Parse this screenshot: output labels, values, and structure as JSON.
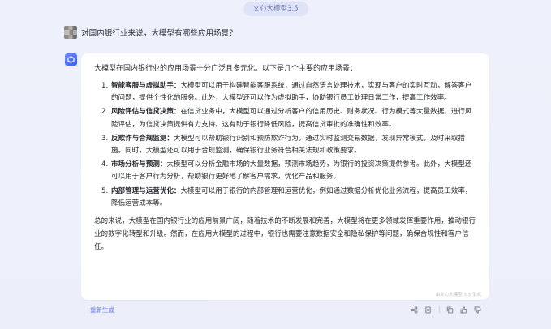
{
  "header": {
    "model_label": "文心大模型3.5"
  },
  "user": {
    "question": "对国内银行业来说，大模型有哪些应用场景？"
  },
  "answer": {
    "intro": "大模型在国内银行业的应用场景十分广泛且多元化。以下是几个主要的应用场景：",
    "points": [
      {
        "num": "1.",
        "title": "智能客服与虚拟助手：",
        "text": "大模型可以用于构建智能客服系统，通过自然语言处理技术，实现与客户的实时互动，解答客户的问题，提供个性化的服务。此外，大模型还可以作为虚拟助手，协助银行员工处理日常工作，提高工作效率。"
      },
      {
        "num": "2.",
        "title": "风险评估与信贷决策：",
        "text": "在信贷业务中，大模型可以通过分析客户的信用历史、财务状况、行为模式等大量数据，进行风险评估，为信贷决策提供有力支持。这有助于银行降低风险，提高信贷审批的准确性和效率。"
      },
      {
        "num": "3.",
        "title": "反欺诈与合规监测：",
        "text": "大模型可以帮助银行识别和预防欺诈行为，通过实时监测交易数据，发现异常模式，及时采取措施。同时，大模型还可以用于合规监测，确保银行业务符合相关法规和政策要求。"
      },
      {
        "num": "4.",
        "title": "市场分析与预测：",
        "text": "大模型可以分析金融市场的大量数据，预测市场趋势，为银行的投资决策提供参考。此外，大模型还可以用于客户行为分析，帮助银行更好地了解客户需求，优化产品和服务。"
      },
      {
        "num": "5.",
        "title": "内部管理与运营优化：",
        "text": "大模型可以用于银行的内部管理和运营优化，例如通过数据分析优化业务流程，提高员工效率，降低运营成本等。"
      }
    ],
    "summary": "总的来说，大模型在国内银行业的应用前景广阔，随着技术的不断发展和完善，大模型将在更多领域发挥重要作用，推动银行业的数字化转型和升级。然而，在应用大模型的过程中，银行也需要注意数据安全和隐私保护等问题，确保合规性和客户信任。",
    "ai_note": "由文心大模型 3.5 生成"
  },
  "footer": {
    "regenerate_label": "重新生成"
  },
  "icons": [
    "share-icon",
    "document-icon",
    "copy-icon",
    "thumbs-up-icon",
    "thumbs-down-icon"
  ]
}
